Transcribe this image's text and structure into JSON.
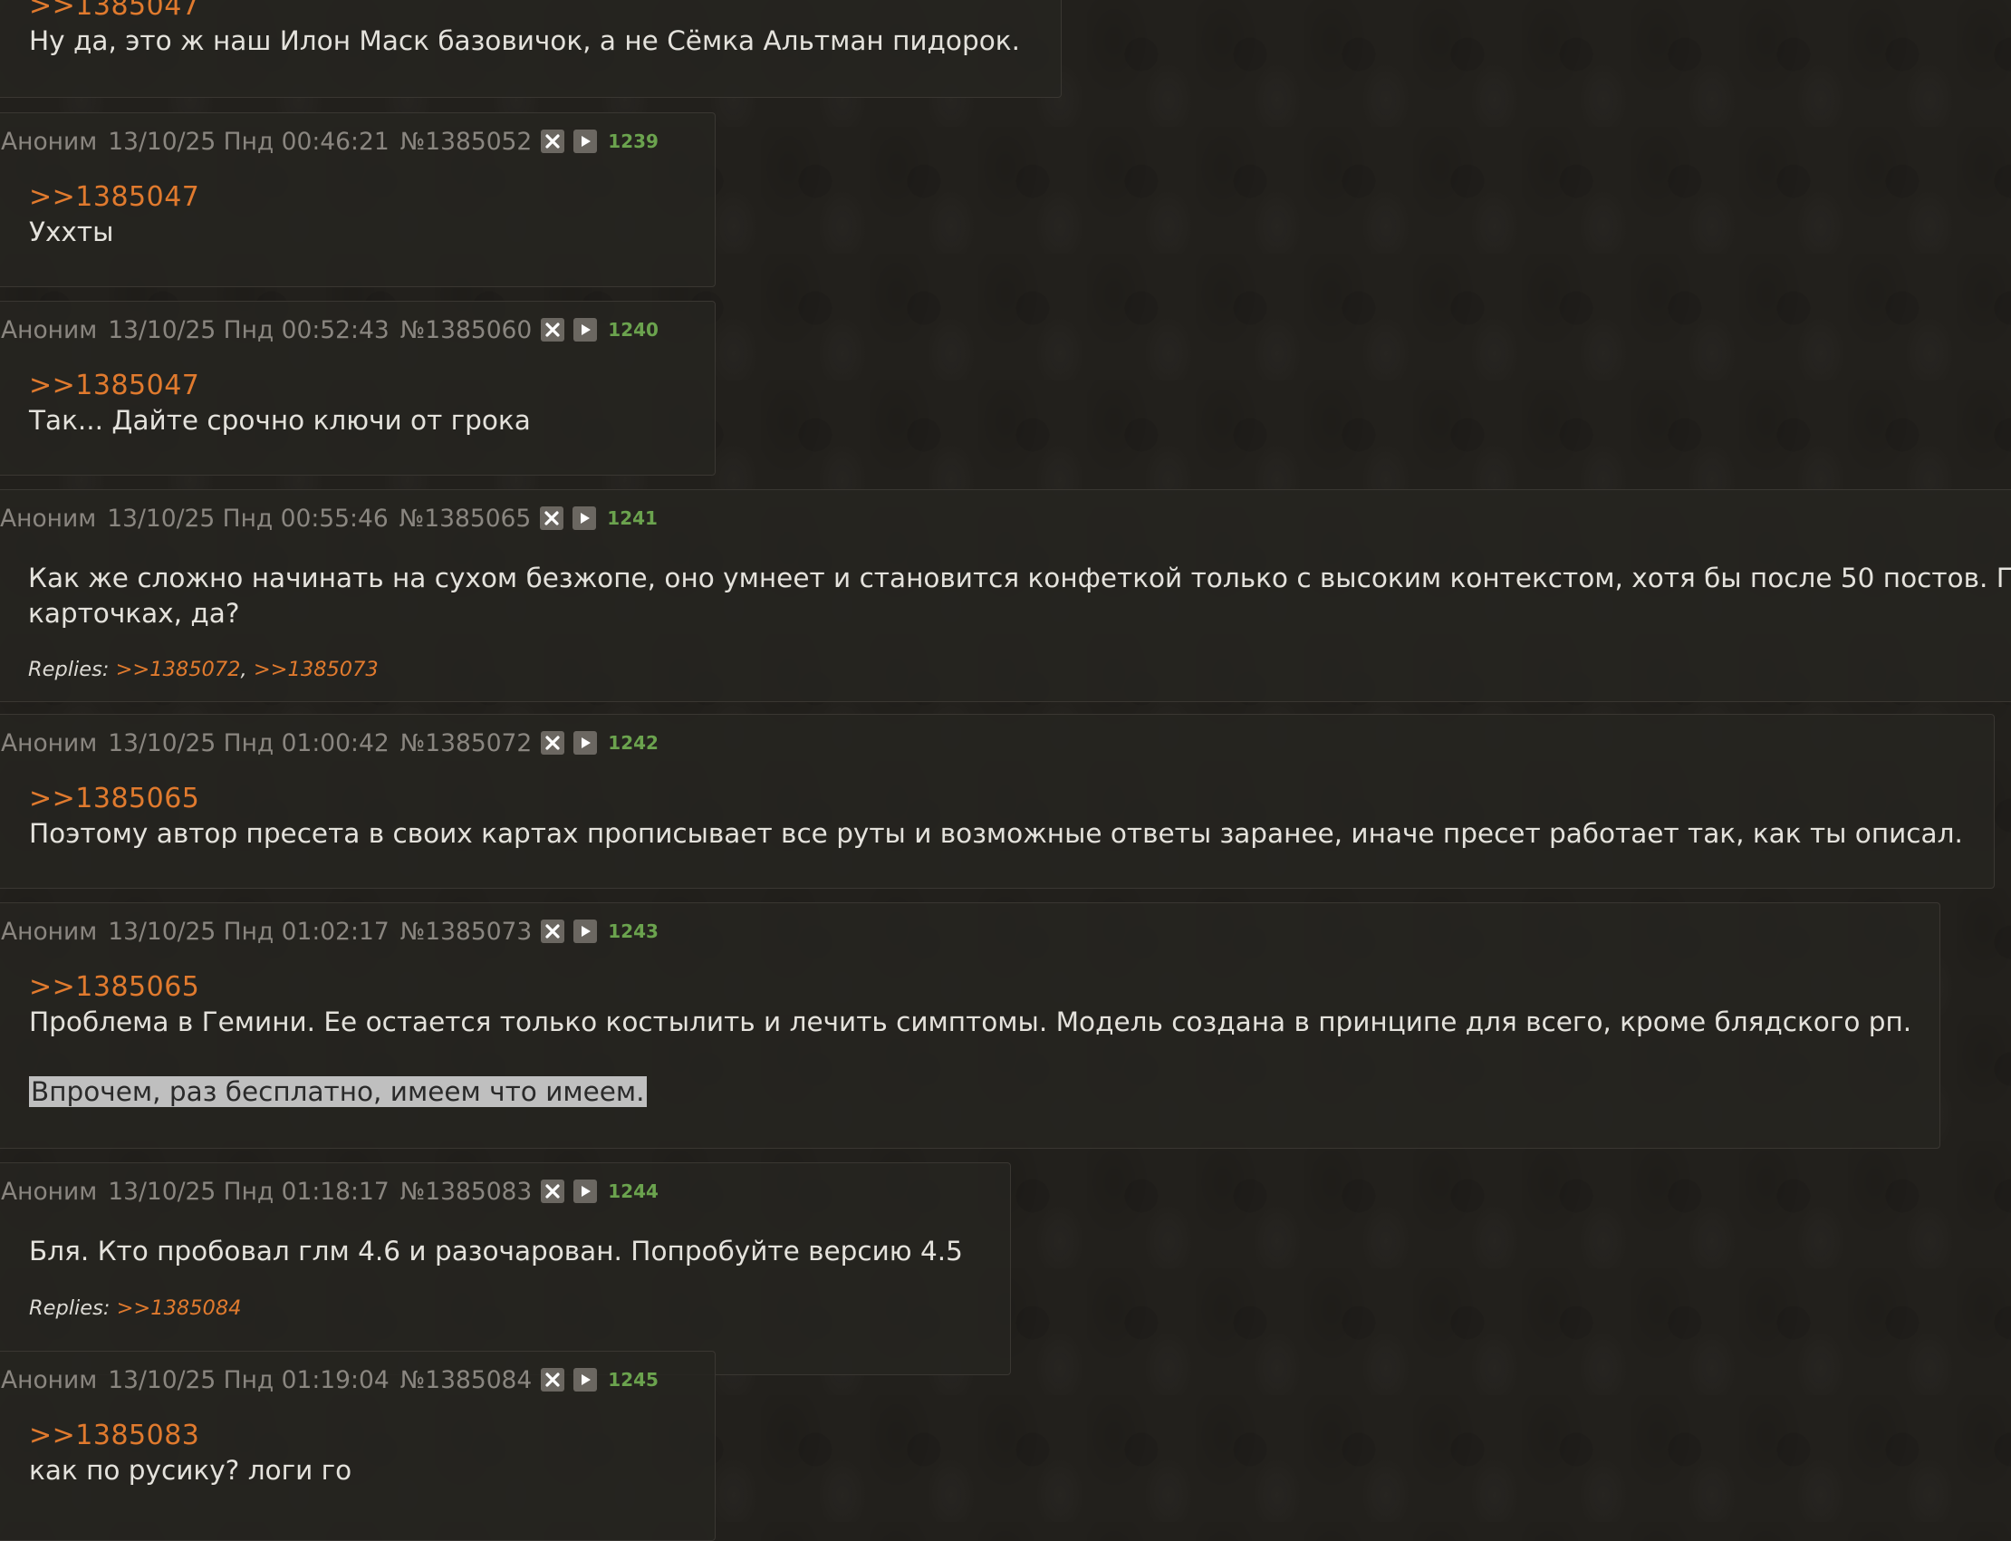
{
  "top_post": {
    "reply_ref": ">>1385047",
    "text": "Ну да, это ж наш Илон Маск базовичок, а не Сёмка Альтман пидорок."
  },
  "posts": [
    {
      "name": "Аноним",
      "date": "13/10/25 Пнд 00:46:21",
      "num": "№1385052",
      "count": "1239",
      "reply_ref": ">>1385047",
      "lines": [
        "Ухxты"
      ]
    },
    {
      "name": "Аноним",
      "date": "13/10/25 Пнд 00:52:43",
      "num": "№1385060",
      "count": "1240",
      "reply_ref": ">>1385047",
      "lines": [
        "Так... Дайте срочно ключи от грока"
      ]
    },
    {
      "name": "Аноним",
      "date": "13/10/25 Пнд 00:55:46",
      "num": "№1385065",
      "count": "1241",
      "lines": [
        "Как же сложно начинать на сухом безжопе, оно умнеет и становится конфеткой только с высоким контекстом, хотя бы после 50 постов. П",
        "карточках, да?"
      ],
      "replies_label": "Replies:",
      "replies": [
        ">>1385072",
        ">>1385073"
      ]
    },
    {
      "name": "Аноним",
      "date": "13/10/25 Пнд 01:00:42",
      "num": "№1385072",
      "count": "1242",
      "reply_ref": ">>1385065",
      "lines": [
        "Поэтому автор пресета в своих картах прописывает все руты и возможные ответы заранее, иначе пресет работает так, как ты описал."
      ]
    },
    {
      "name": "Аноним",
      "date": "13/10/25 Пнд 01:02:17",
      "num": "№1385073",
      "count": "1243",
      "reply_ref": ">>1385065",
      "lines": [
        "Проблема в Гемини. Ее остается только костылить и лечить симптомы. Модель создана в принципе для всего, кроме блядского рп."
      ],
      "selected_line": "Впрочем, раз бесплатно, имеем что имеем."
    },
    {
      "name": "Аноним",
      "date": "13/10/25 Пнд 01:18:17",
      "num": "№1385083",
      "count": "1244",
      "lines": [
        "Бля. Кто пробовал глм 4.6 и разочарован. Попробуйте версию 4.5"
      ],
      "replies_label": "Replies:",
      "replies": [
        ">>1385084"
      ]
    },
    {
      "name": "Аноним",
      "date": "13/10/25 Пнд 01:19:04",
      "num": "№1385084",
      "count": "1245",
      "reply_ref": ">>1385083",
      "lines": [
        "как по русику? логи го"
      ]
    }
  ],
  "colors": {
    "background": "#22201c",
    "post_bg": "#262420",
    "reply_link": "#e07a2e",
    "post_count": "#6ba34e",
    "header_text": "#8a8680",
    "selection": "#bfbfbf"
  },
  "icons": {
    "hide_button": "close-x-icon",
    "play_button": "play-triangle-icon"
  }
}
